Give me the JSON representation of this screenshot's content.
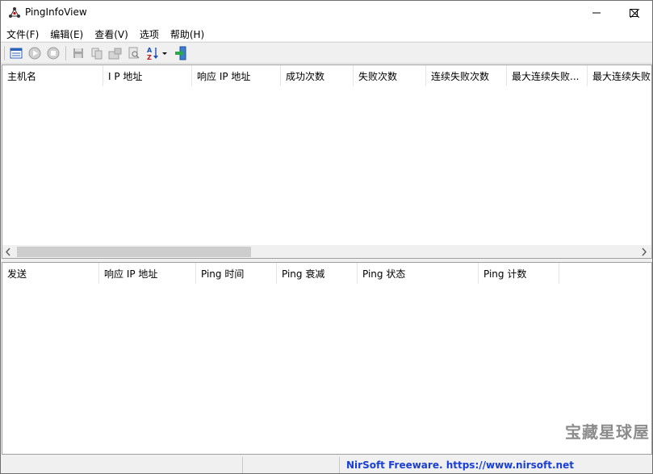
{
  "window": {
    "title": "PingInfoView"
  },
  "menu": {
    "items": [
      "文件(F)",
      "编辑(E)",
      "查看(V)",
      "选项",
      "帮助(H)"
    ]
  },
  "toolbar": {
    "icons": [
      "properties-icon",
      "start-icon",
      "stop-icon",
      "save-icon",
      "copy-icon",
      "html-report-icon",
      "find-icon",
      "sort-icon",
      "exit-icon"
    ]
  },
  "upper_table": {
    "columns": [
      "主机名",
      "I P 地址",
      "响应 IP 地址",
      "成功次数",
      "失败次数",
      "连续失败次数",
      "最大连续失败...",
      "最大连续失败"
    ]
  },
  "lower_table": {
    "columns": [
      "发送",
      "响应 IP 地址",
      "Ping 时间",
      "Ping 衰减",
      "Ping 状态",
      "Ping 计数"
    ]
  },
  "statusbar": {
    "link": "NirSoft Freeware. https://www.nirsoft.net"
  },
  "watermark": "宝藏星球屋"
}
